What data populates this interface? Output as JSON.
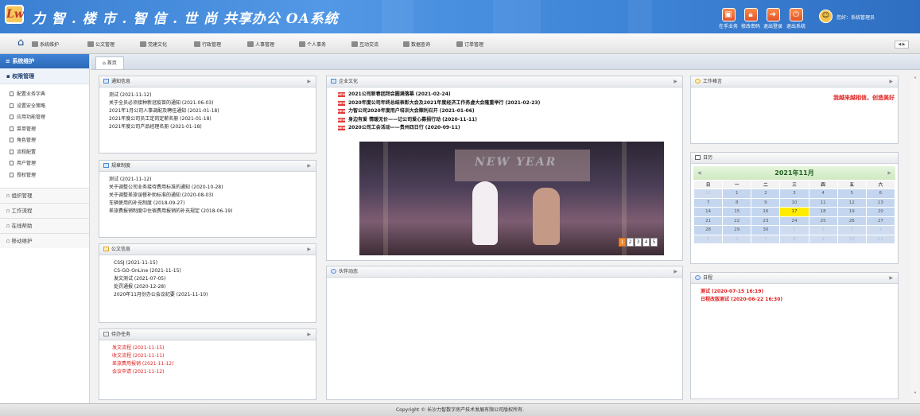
{
  "header": {
    "logo": "Lw",
    "title": "力 智 . 楼 市 . 智 信 . 世 尚 共享办公 OA系统",
    "buttons": [
      {
        "label": "在手业务",
        "icon": "briefcase-icon"
      },
      {
        "label": "修改密码",
        "icon": "lock-icon"
      },
      {
        "label": "退出登录",
        "icon": "logout-icon"
      },
      {
        "label": "退出系统",
        "icon": "power-icon"
      }
    ],
    "greeting": "您好：系统管理员"
  },
  "menubar": {
    "items": [
      "系统维护",
      "公文管理",
      "党建文化",
      "行政管理",
      "人事管理",
      "个人事务",
      "互动交流",
      "数据查询",
      "订单管理"
    ]
  },
  "sidebar": {
    "title": "系统维护",
    "active_group": "权限管理",
    "sub_items": [
      "配置业务字典",
      "设置安全策略",
      "应用功能管理",
      "菜单管理",
      "角色管理",
      "流程配置",
      "用户管理",
      "授权管理"
    ],
    "groups": [
      "组织管理",
      "工作流程",
      "在线帮助",
      "移动维护"
    ]
  },
  "tabbar": {
    "home": "首页"
  },
  "panels": {
    "notice": {
      "title": "通知信息",
      "items": [
        "测试 (2021-11-12)",
        "关于全员必须接种新冠疫苗的通知 (2021-06-03)",
        "2021年1月公司人事调配及聘任通知 (2021-01-18)",
        "2021年度公司员工定岗定薪名册 (2021-01-18)",
        "2021年度公司产品经理名册 (2021-01-18)"
      ]
    },
    "rules": {
      "title": "规章制度",
      "items": [
        "测试 (2021-11-12)",
        "关于调整公司业务接待费用标准的通知 (2020-10-28)",
        "关于调整差旅误餐补助标准的通知 (2020-08-03)",
        "车辆使用的补充制度 (2018-09-27)",
        "差旅费报销制度中住宿费用报销的补充规定 (2018-06-19)"
      ]
    },
    "docs": {
      "title": "公文信息",
      "items": [
        "CSSJ (2021-11-15)",
        "CS-GO-OnLine (2021-11-15)",
        "发文测试 (2021-07-05)",
        "处罚通报 (2020-12-28)",
        "2020年11月份办公会议纪要 (2021-11-10)"
      ]
    },
    "todo": {
      "title": "待办任务",
      "items": [
        "发文流程 (2021-11-15)",
        "收文流程 (2021-11-11)",
        "差旅费用报销 (2021-11-12)",
        "会议申请 (2021-11-12)"
      ]
    },
    "culture": {
      "title": "企业文化",
      "tag": "NEW",
      "items": [
        "2021公司新春团拜会圆满落幕 (2021-02-24)",
        "2020年度公司年终总结表彰大会及2021年度经济工作务虚大会隆重举行 (2021-02-23)",
        "力智公司2020年度用户培训大会顺利召开 (2021-01-06)",
        "身边有爱 情暖无价——记公司爱心募捐行动 (2020-11-11)",
        "2020公司工会活动——贵州四日行 (2020-09-11)"
      ],
      "pager": [
        "1",
        "2",
        "3",
        "4",
        "5"
      ],
      "active_page": "1"
    },
    "partner": {
      "title": "伙伴动态"
    },
    "motto_panel": {
      "title": "工作格言",
      "text": "我越来越相信，创造美好"
    },
    "calendar": {
      "title": "日历",
      "month": "2021年11月",
      "weekdays": [
        "日",
        "一",
        "二",
        "三",
        "四",
        "五",
        "六"
      ],
      "weeks": [
        [
          "31",
          "1",
          "2",
          "3",
          "4",
          "5",
          "6"
        ],
        [
          "7",
          "8",
          "9",
          "10",
          "11",
          "12",
          "13"
        ],
        [
          "14",
          "15",
          "16",
          "17",
          "18",
          "19",
          "20"
        ],
        [
          "21",
          "22",
          "23",
          "24",
          "25",
          "26",
          "27"
        ],
        [
          "28",
          "29",
          "30",
          "1",
          "2",
          "3",
          "4"
        ],
        [
          "5",
          "6",
          "7",
          "8",
          "9",
          "10",
          "11"
        ]
      ],
      "today": "17"
    },
    "schedule": {
      "title": "日程",
      "items": [
        "测试 (2020-07-15 16:19)",
        "日程改版测试 (2020-06-22 16:30)"
      ]
    }
  },
  "footer": "Copyright © 长沙力智数字房产技术发展有限公司版权所有."
}
